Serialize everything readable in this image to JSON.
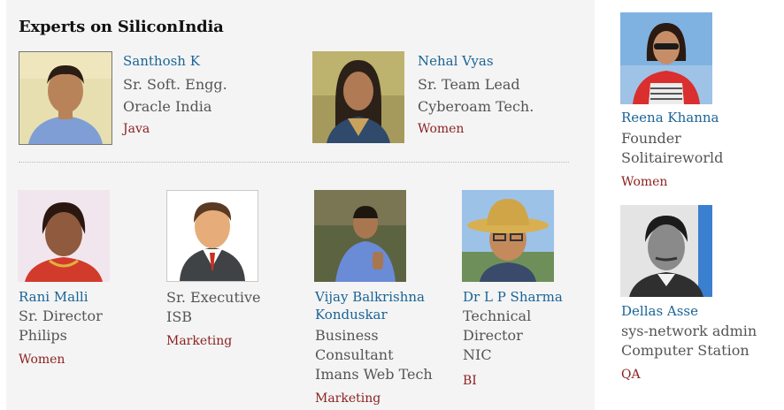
{
  "section_title": "Experts on SiliconIndia",
  "experts": [
    {
      "name": "Santhosh K",
      "lines": [
        "Sr. Soft. Engg.",
        "Oracle India"
      ],
      "tag": "Java"
    },
    {
      "name": "Nehal Vyas",
      "lines": [
        "Sr. Team Lead",
        "Cyberoam Tech."
      ],
      "tag": "Women"
    },
    {
      "name": "Reena Khanna",
      "lines": [
        "Founder",
        "Solitaireworld"
      ],
      "tag": "Women"
    },
    {
      "name": "Rani Malli",
      "lines": [
        "Sr. Director",
        "Philips"
      ],
      "tag": "Women"
    },
    {
      "name": "",
      "lines": [
        "Sr. Executive",
        "ISB"
      ],
      "tag": "Marketing"
    },
    {
      "name_lines": [
        "Vijay Balkrishna",
        "Konduskar"
      ],
      "lines": [
        "Business",
        "Consultant",
        "Imans Web Tech"
      ],
      "tag": "Marketing"
    },
    {
      "name": "Dr L P Sharma",
      "lines": [
        "Technical",
        "Director",
        "NIC"
      ],
      "tag": "BI"
    },
    {
      "name": "Dellas Asse",
      "lines": [
        "sys-network admin",
        "Computer Station"
      ],
      "tag": "QA"
    }
  ]
}
